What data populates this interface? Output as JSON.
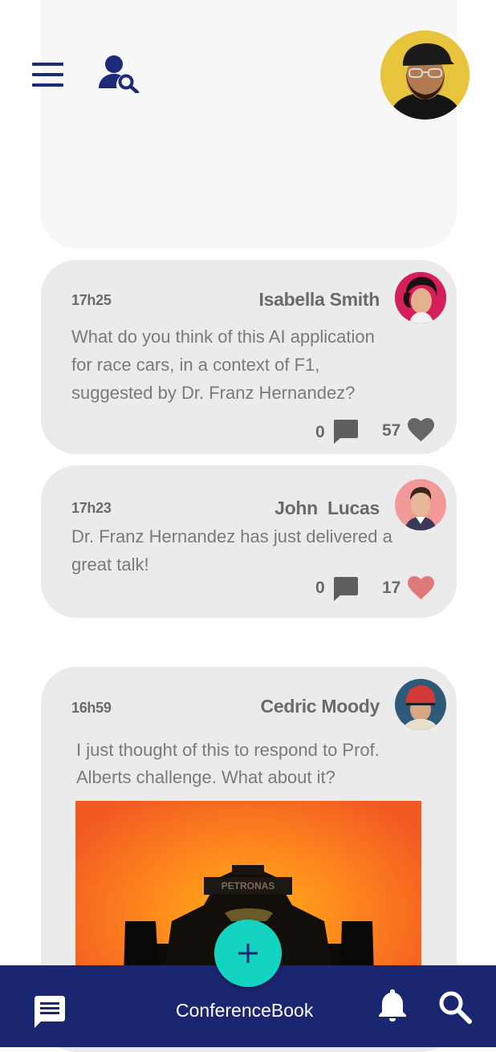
{
  "header": {
    "menu_icon": "hamburger-menu-icon",
    "search_user_icon": "user-search-icon",
    "profile_avatar": "profile-avatar"
  },
  "posts": [
    {
      "time": "17h25",
      "author": "Isabella Smith",
      "text": "What do you think of this AI application for race cars, in a context of F1, suggested by Dr. Franz Hernandez?",
      "comments": "0",
      "likes": "57",
      "liked": false
    },
    {
      "time": "17h23",
      "author": "John  Lucas",
      "text": "Dr. Franz Hernandez has just delivered a great talk!",
      "comments": "0",
      "likes": "17",
      "liked": true
    },
    {
      "time": "16h59",
      "author": "Cedric Moody",
      "text": "I just thought of this to respond to Prof. Alberts challenge. What about it?",
      "image": "race-car-image",
      "image_text": "PETRONAS"
    }
  ],
  "bottom_bar": {
    "brand": "ConferenceBook",
    "chat_icon": "chat-icon",
    "bell_icon": "bell-icon",
    "search_icon": "search-icon"
  },
  "fab": {
    "icon": "plus-icon",
    "label": "+"
  },
  "colors": {
    "navy": "#1a2670",
    "teal": "#13d3c1",
    "card": "#ebebeb",
    "liked_heart": "#e07a7a",
    "heart": "#6b6b6b"
  }
}
